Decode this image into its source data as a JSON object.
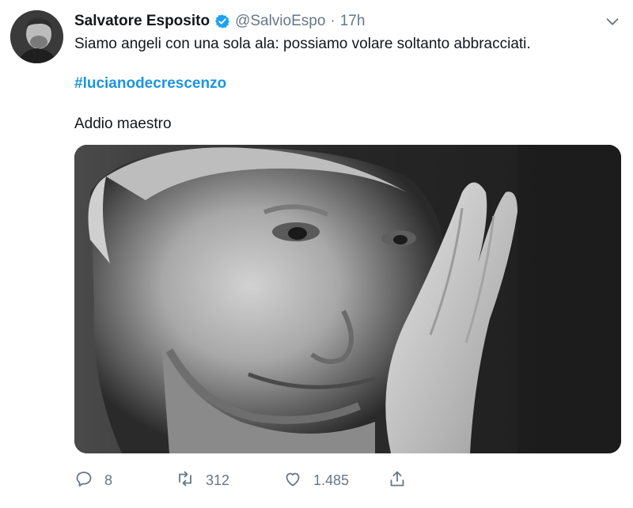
{
  "tweet": {
    "author": {
      "display_name": "Salvatore Esposito",
      "handle": "@SalvioEspo",
      "verified": true,
      "avatar_icon": "profile-photo"
    },
    "separator": "·",
    "time": "17h",
    "text_line_1": "Siamo angeli con una sola ala: possiamo volare soltanto abbracciati.",
    "hashtag": "#lucianodecrescenzo",
    "text_line_3": "Addio maestro",
    "media": {
      "icon": "black-and-white-portrait-photo"
    },
    "actions": {
      "reply": {
        "icon": "reply-icon",
        "count": "8"
      },
      "retweet": {
        "icon": "retweet-icon",
        "count": "312"
      },
      "like": {
        "icon": "heart-icon",
        "count": "1.485"
      },
      "share": {
        "icon": "share-icon"
      }
    }
  },
  "colors": {
    "text": "#14171a",
    "secondary": "#657786",
    "link": "#1b95e0",
    "verified": "#1da1f2"
  }
}
